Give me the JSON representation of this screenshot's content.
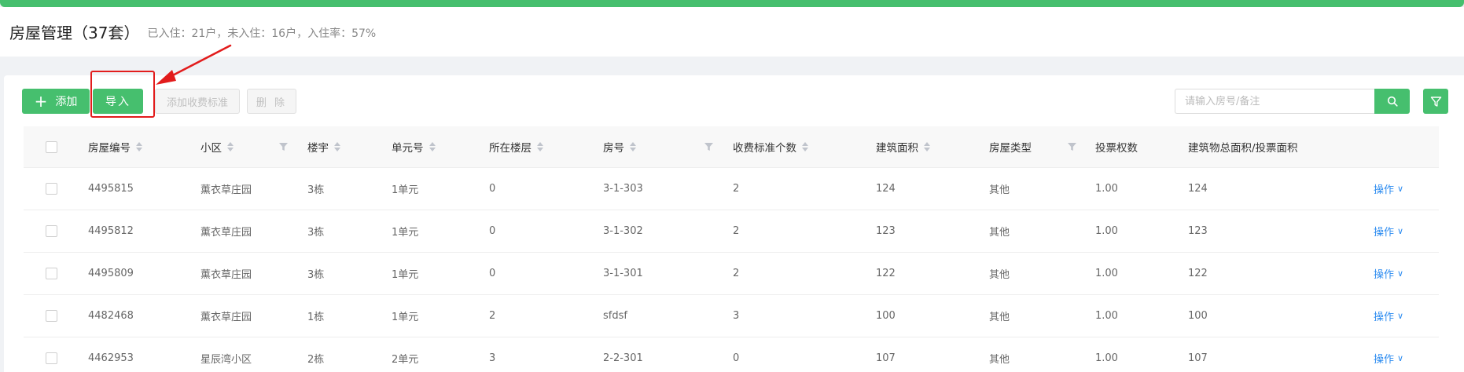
{
  "header": {
    "title": "房屋管理（37套）",
    "stats": "已入住：21户，未入住：16户，入住率：57%"
  },
  "toolbar": {
    "add_label": "添加",
    "import_label": "导入",
    "add_fee_label": "添加收费标准",
    "delete_label": "删 除",
    "search_placeholder": "请输入房号/备注"
  },
  "table": {
    "columns": [
      "房屋编号",
      "小区",
      "楼宇",
      "单元号",
      "所在楼层",
      "房号",
      "收费标准个数",
      "建筑面积",
      "房屋类型",
      "投票权数",
      "建筑物总面积/投票面积"
    ],
    "action_label": "操作",
    "rows": [
      [
        "4495815",
        "薰衣草庄园",
        "3栋",
        "1单元",
        "0",
        "3-1-303",
        "2",
        "124",
        "其他",
        "1.00",
        "124"
      ],
      [
        "4495812",
        "薰衣草庄园",
        "3栋",
        "1单元",
        "0",
        "3-1-302",
        "2",
        "123",
        "其他",
        "1.00",
        "123"
      ],
      [
        "4495809",
        "薰衣草庄园",
        "3栋",
        "1单元",
        "0",
        "3-1-301",
        "2",
        "122",
        "其他",
        "1.00",
        "122"
      ],
      [
        "4482468",
        "薰衣草庄园",
        "1栋",
        "1单元",
        "2",
        "sfdsf",
        "3",
        "100",
        "其他",
        "1.00",
        "100"
      ],
      [
        "4462953",
        "星辰湾小区",
        "2栋",
        "2单元",
        "3",
        "2-2-301",
        "0",
        "107",
        "其他",
        "1.00",
        "107"
      ]
    ]
  },
  "colors": {
    "brand_green": "#46bf6e",
    "annotation_red": "#e21c1c",
    "link_blue": "#2d8cf0"
  }
}
